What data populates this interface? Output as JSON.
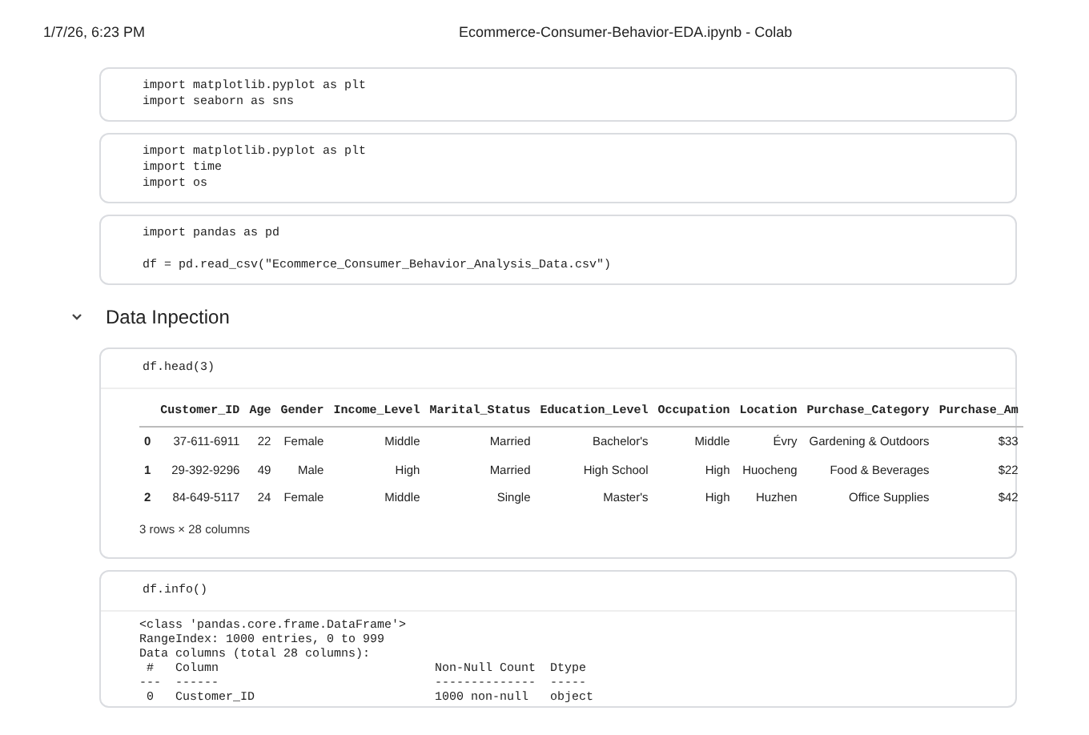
{
  "header": {
    "timestamp": "1/7/26, 6:23 PM",
    "title": "Ecommerce-Consumer-Behavior-EDA.ipynb - Colab"
  },
  "cells_top": [
    {
      "blocks": [
        [
          "import matplotlib.pyplot as plt",
          "import seaborn as sns"
        ]
      ]
    },
    {
      "blocks": [
        [
          "import matplotlib.pyplot as plt",
          "import time",
          "import os"
        ]
      ]
    },
    {
      "blocks": [
        [
          "import pandas as pd"
        ],
        [
          "df = pd.read_csv(\"Ecommerce_Consumer_Behavior_Analysis_Data.csv\")"
        ]
      ]
    }
  ],
  "section": {
    "title": "Data Inpection",
    "expanded": true
  },
  "head_cell": {
    "code": "df.head(3)",
    "columns": [
      "",
      "Customer_ID",
      "Age",
      "Gender",
      "Income_Level",
      "Marital_Status",
      "Education_Level",
      "Occupation",
      "Location",
      "Purchase_Category",
      "Purchase_Am"
    ],
    "rows": [
      [
        "0",
        "37-611-6911",
        "22",
        "Female",
        "Middle",
        "Married",
        "Bachelor's",
        "Middle",
        "Évry",
        "Gardening & Outdoors",
        "$33"
      ],
      [
        "1",
        "29-392-9296",
        "49",
        "Male",
        "High",
        "Married",
        "High School",
        "High",
        "Huocheng",
        "Food & Beverages",
        "$22"
      ],
      [
        "2",
        "84-649-5117",
        "24",
        "Female",
        "Middle",
        "Single",
        "Master's",
        "High",
        "Huzhen",
        "Office Supplies",
        "$42"
      ]
    ],
    "summary": "3 rows × 28 columns"
  },
  "info_cell": {
    "code": "df.info()",
    "output": [
      "<class 'pandas.core.frame.DataFrame'>",
      "RangeIndex: 1000 entries, 0 to 999",
      "Data columns (total 28 columns):",
      " #   Column                              Non-Null Count  Dtype ",
      "---  ------                              --------------  ----- ",
      " 0   Customer_ID                         1000 non-null   object"
    ]
  }
}
